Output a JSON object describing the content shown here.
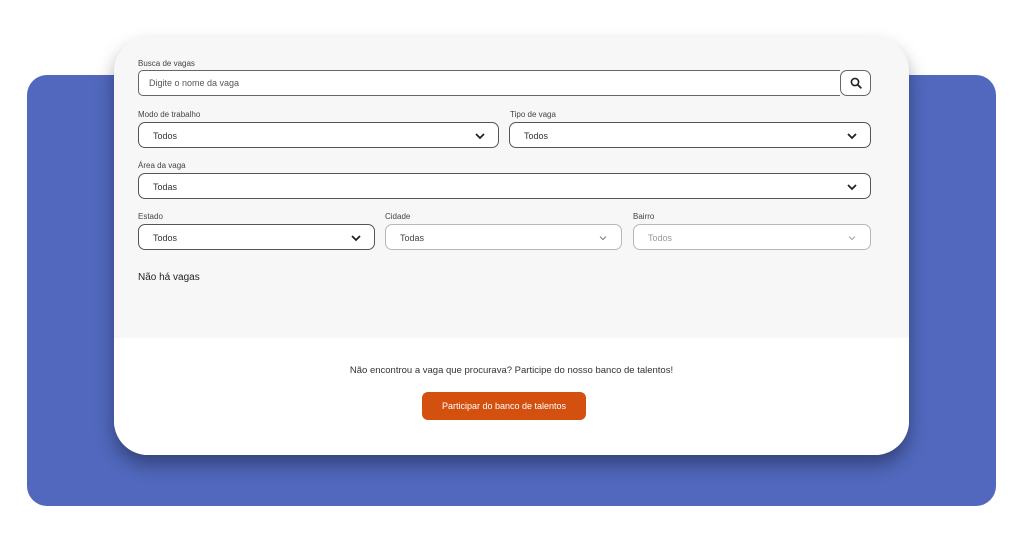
{
  "search": {
    "label": "Busca de vagas",
    "placeholder": "Digite o nome da vaga",
    "icon": "search-icon"
  },
  "filters": {
    "modo_trabalho": {
      "label": "Modo de trabalho",
      "value": "Todos"
    },
    "tipo_vaga": {
      "label": "Tipo de vaga",
      "value": "Todos"
    },
    "area_vaga": {
      "label": "Área da vaga",
      "value": "Todas"
    },
    "estado": {
      "label": "Estado",
      "value": "Todos"
    },
    "cidade": {
      "label": "Cidade",
      "value": "Todas"
    },
    "bairro": {
      "label": "Bairro",
      "value": "Todos"
    }
  },
  "results": {
    "empty_message": "Não há vagas"
  },
  "talent_bank": {
    "prompt": "Não encontrou a vaga que procurava? Participe do nosso banco de talentos!",
    "button_label": "Participar do banco de talentos"
  },
  "colors": {
    "background_panel": "#5168be",
    "accent_button": "#d4500f",
    "card": "#f7f7f7"
  }
}
